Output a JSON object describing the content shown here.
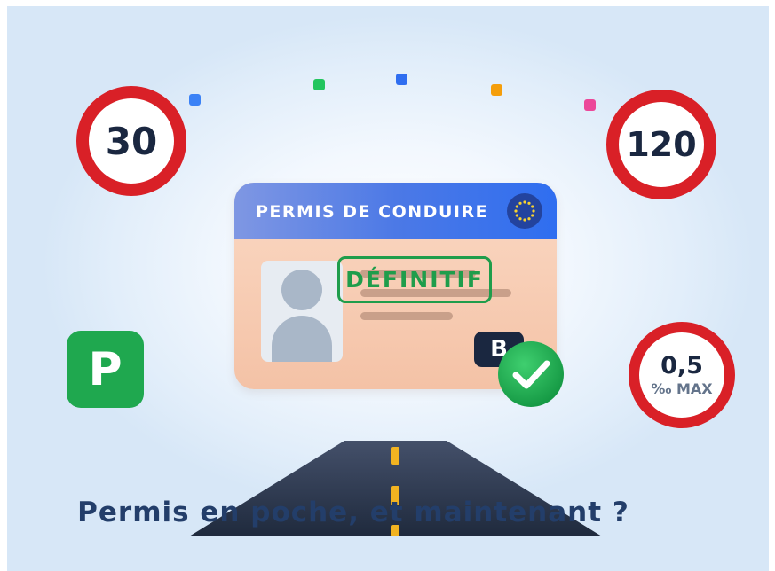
{
  "speed_sign_left": {
    "value": "30"
  },
  "speed_sign_right": {
    "value": "120"
  },
  "alcohol_sign": {
    "value": "0,5",
    "unit": "‰ MAX"
  },
  "parking_sign": {
    "letter": "P"
  },
  "license_card": {
    "title": "PERMIS DE CONDUIRE",
    "stamp": "DÉFINITIF",
    "category": "B"
  },
  "caption": "Permis en poche, et maintenant ?",
  "colors": {
    "sign_red": "#d92027",
    "card_blue": "#2f6ef0",
    "stamp_green": "#1f9d4b",
    "parking_green": "#1fa84f",
    "road": "#2f3a4f",
    "lane_yellow": "#f2b321"
  },
  "icons": [
    "eu-flag-icon",
    "person-silhouette-icon",
    "checkmark-icon"
  ]
}
